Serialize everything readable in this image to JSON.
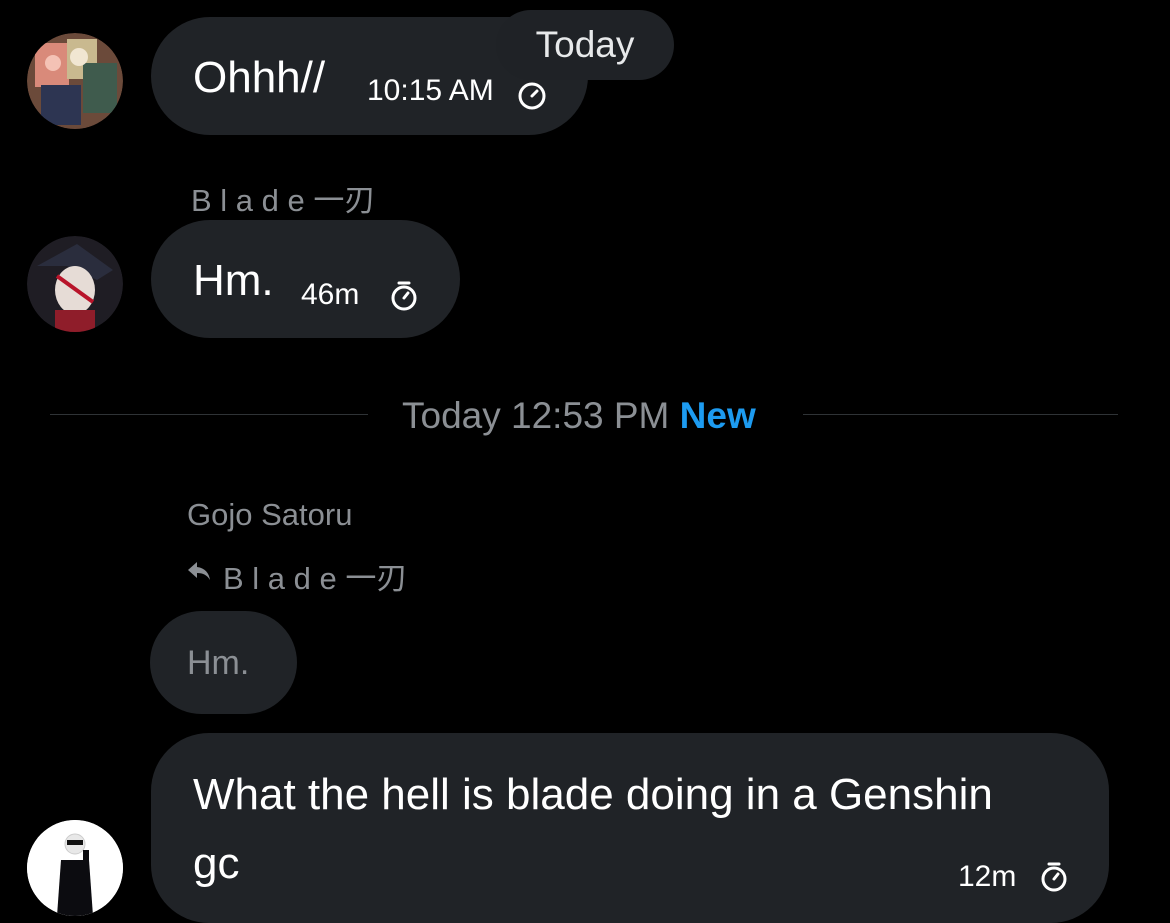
{
  "messages": [
    {
      "text": "Ohhh//",
      "time": "10:15 AM",
      "timer_icon": "timer-icon"
    },
    {
      "sender": "B l a d e 一刃",
      "text": "Hm.",
      "time": "46m",
      "timer_icon": "timer-icon"
    }
  ],
  "date_pill": "Today",
  "divider": {
    "label": "Today 12:53 PM",
    "badge": "New"
  },
  "reply_message": {
    "sender": "Gojo Satoru",
    "reply_icon": "reply-arrow-icon",
    "replying_to": "B l a d e 一刃",
    "quoted_text": "Hm.",
    "text_line1": "What the hell is blade doing in a Genshin",
    "text_line2": "gc",
    "time": "12m",
    "timer_icon": "timer-icon"
  },
  "colors": {
    "background": "#000000",
    "bubble": "#202327",
    "muted_text": "#8b8f94",
    "accent_new": "#1d9bf0"
  }
}
